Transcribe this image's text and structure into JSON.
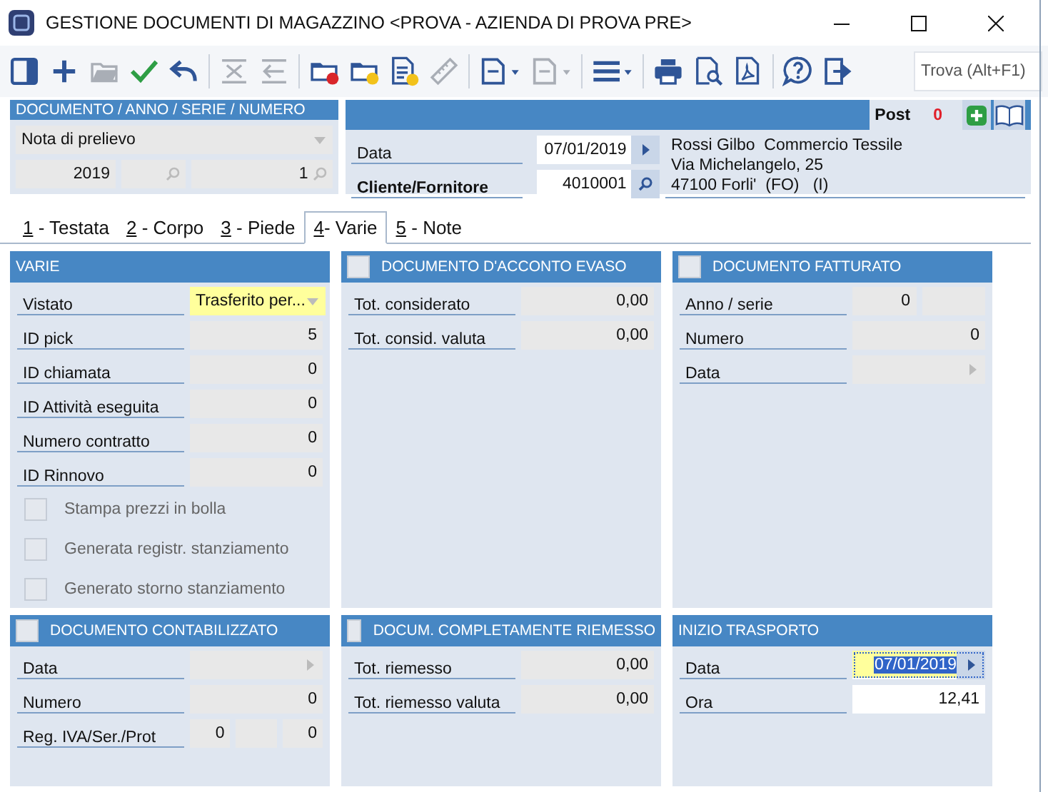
{
  "window": {
    "title": "GESTIONE DOCUMENTI DI MAGAZZINO <PROVA - AZIENDA DI PROVA PRE>"
  },
  "toolbar": {
    "items": [
      {
        "kind": "panel",
        "disabled": false
      },
      {
        "kind": "add",
        "disabled": false
      },
      {
        "kind": "open",
        "disabled": true
      },
      {
        "kind": "confirm",
        "disabled": false
      },
      {
        "kind": "undo",
        "disabled": false
      },
      {
        "kind": "separator"
      },
      {
        "kind": "delete",
        "disabled": true
      },
      {
        "kind": "revert",
        "disabled": true
      },
      {
        "kind": "separator"
      },
      {
        "kind": "folder_red",
        "disabled": false
      },
      {
        "kind": "folder_yellow",
        "disabled": false
      },
      {
        "kind": "document_yellow",
        "disabled": false
      },
      {
        "kind": "ruler",
        "disabled": true
      },
      {
        "kind": "separator"
      },
      {
        "kind": "page_menu",
        "disabled": false
      },
      {
        "kind": "page_menu",
        "disabled": true
      },
      {
        "kind": "separator"
      },
      {
        "kind": "list_menu",
        "disabled": false
      },
      {
        "kind": "separator"
      },
      {
        "kind": "print",
        "disabled": false
      },
      {
        "kind": "preview",
        "disabled": false
      },
      {
        "kind": "pdf",
        "disabled": false
      },
      {
        "kind": "separator"
      },
      {
        "kind": "help",
        "disabled": false
      },
      {
        "kind": "exit",
        "disabled": false
      }
    ],
    "search": {
      "placeholder": "Trova (Alt+F1)"
    }
  },
  "document": {
    "title": "DOCUMENTO / ANNO / SERIE / NUMERO",
    "type": "Nota di prelievo",
    "year": "2019",
    "number": "1"
  },
  "counterpart": {
    "post_label": "Post",
    "post_count": "0",
    "fields": [
      {
        "label": "Data",
        "value": "07/01/2019",
        "kind": "date",
        "bold": false
      },
      {
        "label": "Cliente/Fornitore",
        "value": "4010001",
        "kind": "lookup",
        "bold": true
      }
    ],
    "address": [
      "Rossi Gilbo  Commercio Tessile",
      "Via Michelangelo, 25",
      "47100 Forli'  (FO)   (I)"
    ]
  },
  "tabs": [
    {
      "key": "1",
      "label": " - Testata",
      "selected": false
    },
    {
      "key": "2",
      "label": " - Corpo",
      "selected": false
    },
    {
      "key": "3",
      "label": " - Piede",
      "selected": false
    },
    {
      "key": "4",
      "label": "- Varie",
      "selected": true
    },
    {
      "key": "5",
      "label": " - Note",
      "selected": false
    }
  ],
  "panels": [
    {
      "title": "VARIE",
      "rows": [
        {
          "kind": "field",
          "label": "Vistato",
          "fields": [
            {
              "kind": "dropdown",
              "editable": false,
              "highlighted": true,
              "text_selected": false,
              "value": "Trasferito per..."
            }
          ]
        },
        {
          "kind": "field",
          "label": "ID pick",
          "fields": [
            {
              "kind": "plain",
              "editable": false,
              "highlighted": false,
              "text_selected": false,
              "value": "5"
            }
          ]
        },
        {
          "kind": "field",
          "label": "ID chiamata",
          "fields": [
            {
              "kind": "plain",
              "editable": false,
              "highlighted": false,
              "text_selected": false,
              "value": "0"
            }
          ]
        },
        {
          "kind": "field",
          "label": "ID Attività eseguita",
          "fields": [
            {
              "kind": "plain",
              "editable": false,
              "highlighted": false,
              "text_selected": false,
              "value": "0"
            }
          ]
        },
        {
          "kind": "field",
          "label": "Numero contratto",
          "fields": [
            {
              "kind": "plain",
              "editable": false,
              "highlighted": false,
              "text_selected": false,
              "value": "0"
            }
          ]
        },
        {
          "kind": "field",
          "label": "ID Rinnovo",
          "fields": [
            {
              "kind": "plain",
              "editable": false,
              "highlighted": false,
              "text_selected": false,
              "value": "0"
            }
          ]
        },
        {
          "kind": "checkbox",
          "label": "Stampa prezzi in bolla",
          "checked": false,
          "disabled": true
        },
        {
          "kind": "checkbox",
          "label": "Generata registr. stanziamento",
          "checked": false,
          "disabled": true
        },
        {
          "kind": "checkbox",
          "label": "Generato storno stanziamento",
          "checked": false,
          "disabled": true
        }
      ]
    },
    {
      "title": "DOCUMENTO D'ACCONTO EVASO",
      "checked": false,
      "rows": [
        {
          "kind": "field",
          "label": "Tot. considerato",
          "fields": [
            {
              "kind": "plain",
              "editable": false,
              "highlighted": false,
              "text_selected": false,
              "value": "0,00"
            }
          ]
        },
        {
          "kind": "field",
          "label": "Tot. consid. valuta",
          "fields": [
            {
              "kind": "plain",
              "editable": false,
              "highlighted": false,
              "text_selected": false,
              "value": "0,00"
            }
          ]
        }
      ]
    },
    {
      "title": "DOCUMENTO FATTURATO",
      "checked": false,
      "rows": [
        {
          "kind": "field",
          "label": "Anno / serie",
          "fields": [
            {
              "kind": "plain",
              "editable": false,
              "highlighted": false,
              "text_selected": false,
              "value": "0"
            },
            {
              "kind": "plain",
              "editable": false,
              "highlighted": false,
              "text_selected": false
            }
          ]
        },
        {
          "kind": "field",
          "label": "Numero",
          "fields": [
            {
              "kind": "plain",
              "editable": false,
              "highlighted": false,
              "text_selected": false,
              "value": "0"
            }
          ]
        },
        {
          "kind": "field",
          "label": "Data",
          "fields": [
            {
              "kind": "date",
              "editable": false,
              "highlighted": false,
              "text_selected": false
            }
          ]
        }
      ]
    },
    {
      "title": "DOCUMENTO CONTABILIZZATO",
      "checked": false,
      "rows": [
        {
          "kind": "field",
          "label": "Data",
          "fields": [
            {
              "kind": "date",
              "editable": false,
              "highlighted": false,
              "text_selected": false
            }
          ]
        },
        {
          "kind": "field",
          "label": "Numero",
          "fields": [
            {
              "kind": "plain",
              "editable": false,
              "highlighted": false,
              "text_selected": false,
              "value": "0"
            }
          ]
        },
        {
          "kind": "field",
          "label": "Reg. IVA/Ser./Prot",
          "fields": [
            {
              "kind": "plain",
              "editable": false,
              "highlighted": false,
              "text_selected": false,
              "value": "0"
            },
            {
              "kind": "plain",
              "editable": false,
              "highlighted": false,
              "text_selected": false
            },
            {
              "kind": "plain",
              "editable": false,
              "highlighted": false,
              "text_selected": false,
              "value": "0"
            }
          ]
        }
      ]
    },
    {
      "title": "DOCUM. COMPLETAMENTE RIEMESSO",
      "checked": false,
      "rows": [
        {
          "kind": "field",
          "label": "Tot. riemesso",
          "fields": [
            {
              "kind": "plain",
              "editable": false,
              "highlighted": false,
              "text_selected": false,
              "value": "0,00"
            }
          ]
        },
        {
          "kind": "field",
          "label": "Tot. riemesso valuta",
          "fields": [
            {
              "kind": "plain",
              "editable": false,
              "highlighted": false,
              "text_selected": false,
              "value": "0,00"
            }
          ]
        }
      ]
    },
    {
      "title": "INIZIO TRASPORTO",
      "rows": [
        {
          "kind": "field",
          "label": "Data",
          "fields": [
            {
              "kind": "date",
              "editable": true,
              "highlighted": true,
              "text_selected": true,
              "value": "07/01/2019"
            }
          ]
        },
        {
          "kind": "field",
          "label": "Ora",
          "fields": [
            {
              "kind": "plain",
              "editable": true,
              "highlighted": false,
              "text_selected": false,
              "value": "12,41"
            }
          ]
        }
      ]
    }
  ]
}
